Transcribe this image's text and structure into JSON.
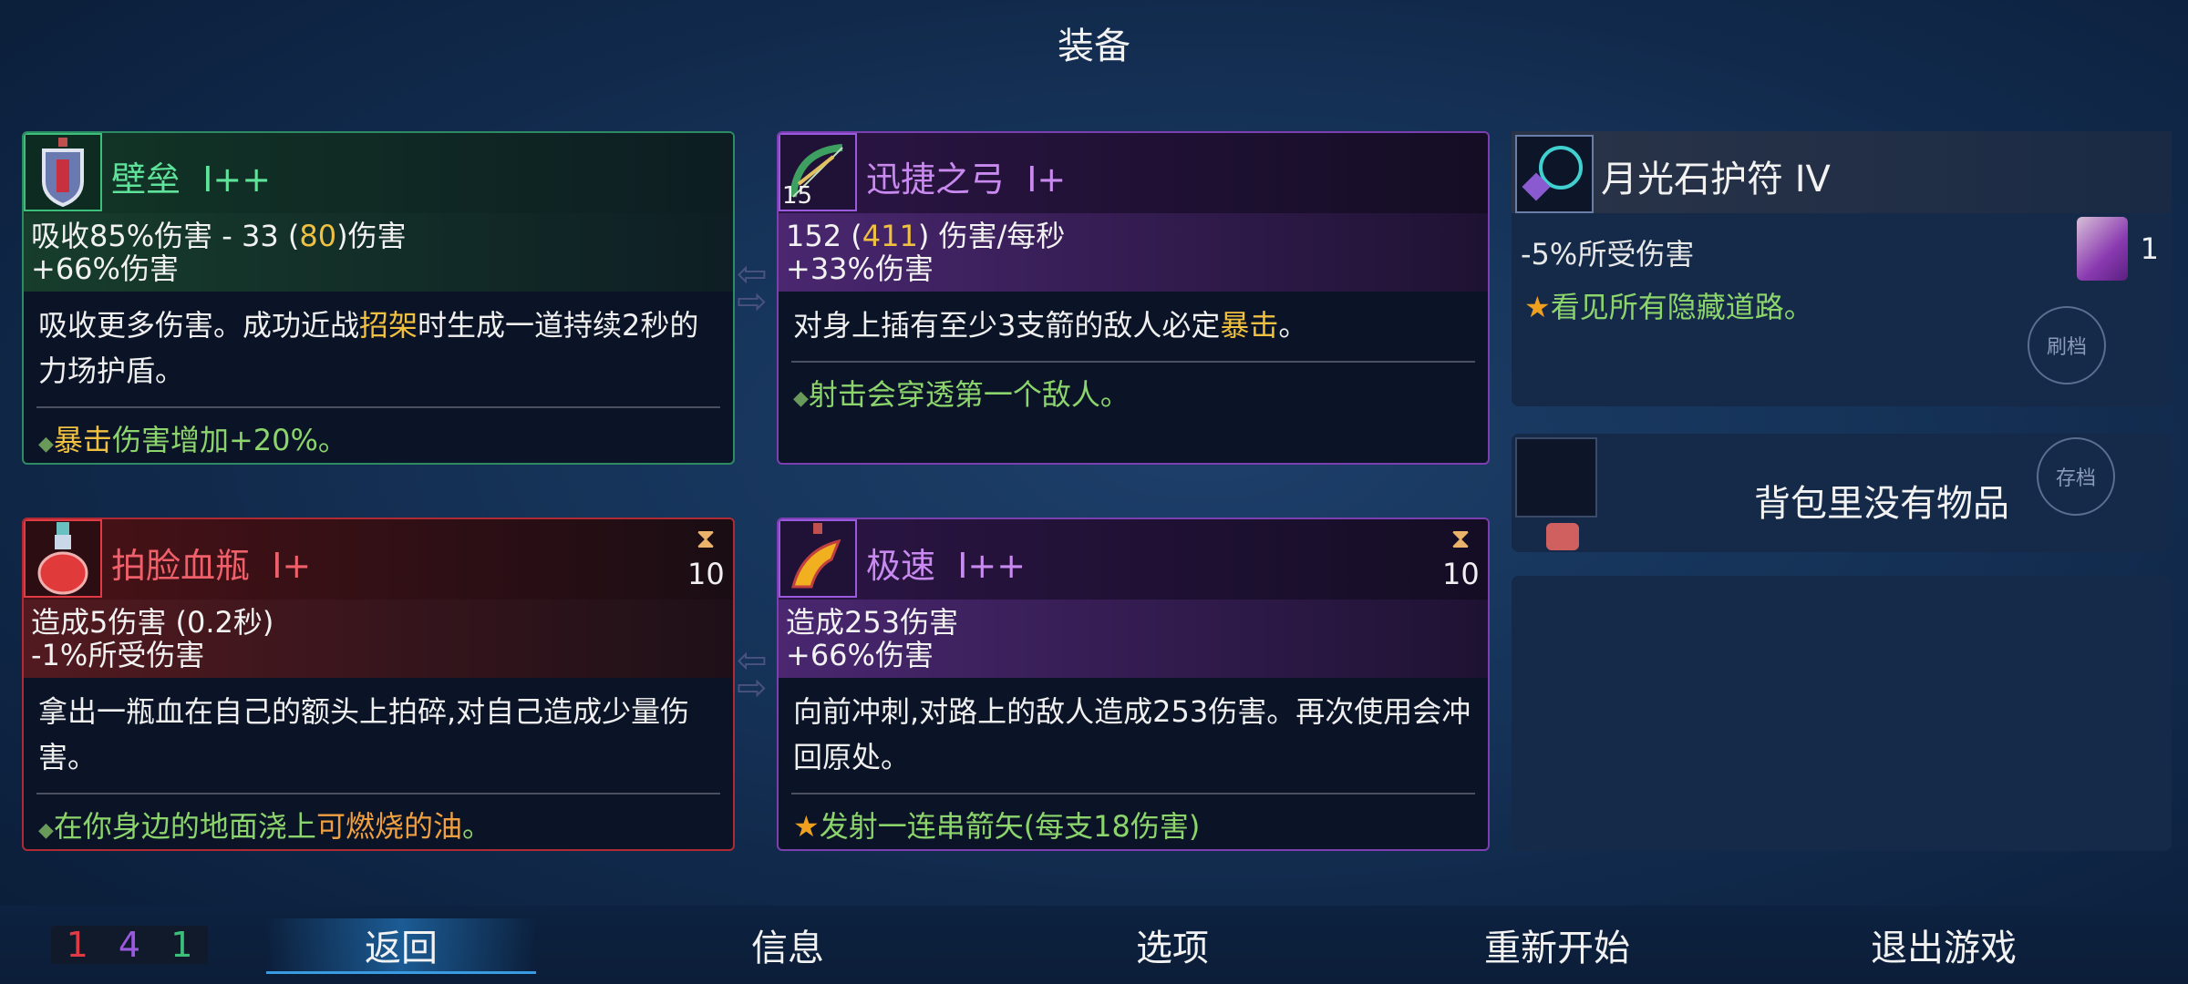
{
  "title": "装备",
  "cards": {
    "bulwark": {
      "name": "壁垒",
      "tier": "I++",
      "stat1_pre": "吸收85%伤害 - 33 (",
      "stat1_hl": "80",
      "stat1_post": ")伤害",
      "stat2": "+66%伤害",
      "desc_pre": "吸收更多伤害。成功近战",
      "desc_hl": "招架",
      "desc_post": "时生成一道持续2秒的力场护盾。",
      "bonus_hl": "暴击",
      "bonus_post": "伤害增加+20%。"
    },
    "bow": {
      "name": "迅捷之弓",
      "tier": "I+",
      "ammo": "15",
      "stat1_pre": "152 (",
      "stat1_hl": "411",
      "stat1_post": ") 伤害/每秒",
      "stat2": "+33%伤害",
      "desc_pre": "对身上插有至少3支箭的敌人必定",
      "desc_hl": "暴击",
      "desc_post": "。",
      "bonus": "射击会穿透第一个敌人。"
    },
    "flask": {
      "name": "拍脸血瓶",
      "tier": "I+",
      "cooldown": "10",
      "stat1": "造成5伤害 (0.2秒)",
      "stat2": "-1%所受伤害",
      "desc": "拿出一瓶血在自己的额头上拍碎,对自己造成少量伤害。",
      "bonus_pre": "在你身边的地面浇上",
      "bonus_hl": "可燃烧的油",
      "bonus_post": "。"
    },
    "speed": {
      "name": "极速",
      "tier": "I++",
      "cooldown": "10",
      "stat1": "造成253伤害",
      "stat2": "+66%伤害",
      "desc": "向前冲刺,对路上的敌人造成253伤害。再次使用会冲回原处。",
      "bonus": "发射一连串箭矢(每支18伤害)"
    }
  },
  "amulet": {
    "name": "月光石护符 IV",
    "stat": "-5%所受伤害",
    "scroll_count": "1",
    "bonus": "看见所有隐藏道路。",
    "reroll_label": "刷档"
  },
  "backpack": {
    "empty_text": "背包里没有物品",
    "save_label": "存档"
  },
  "scrolls": {
    "brutality": "1",
    "tactics": "4",
    "survival": "1"
  },
  "nav": {
    "back": "返回",
    "info": "信息",
    "options": "选项",
    "restart": "重新开始",
    "quit": "退出游戏"
  },
  "colors": {
    "brutality": "#e03a44",
    "tactics": "#9b59e0",
    "survival": "#3cbf7a"
  }
}
